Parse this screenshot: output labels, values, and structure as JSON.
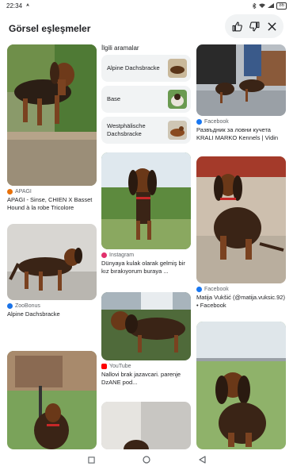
{
  "status": {
    "time": "22:34",
    "battery": "86"
  },
  "header": {
    "title": "Görsel eşleşmeler"
  },
  "related": {
    "title": "İlgili aramalar",
    "items": [
      {
        "label": "Alpine Dachsbracke"
      },
      {
        "label": "Base"
      },
      {
        "label": "Westphälische Dachsbracke"
      }
    ]
  },
  "results": [
    {
      "source": "APAGI",
      "caption": "APAGI - Sinse, CHIEN X Basset Hound à la robe Tricolore"
    },
    {
      "source": "ZooBonus",
      "caption": "Alpine Dachsbracke"
    },
    {
      "source": "Instagram",
      "caption": "Dünyaya kulak olarak gelmiş bir kız bırakıyorum buraya ..."
    },
    {
      "source": "YouTube",
      "caption": "Nallovi brak jazavcari. parenje DzANE pod..."
    },
    {
      "source": "Facebook",
      "caption": "Развъдник за ловни кучета KRALI MARKO Kennels | Vidin"
    },
    {
      "source": "Facebook",
      "caption": "Matija Vukšić (@matija.vuksic.92) • Facebook"
    }
  ],
  "colors": {
    "chip_bg": "#f1f3f4",
    "facebook": "#1877f2",
    "youtube": "#ff0000",
    "instagram": "#e1306c",
    "zoobonus": "#1a73e8",
    "apagi": "#e8710a"
  }
}
